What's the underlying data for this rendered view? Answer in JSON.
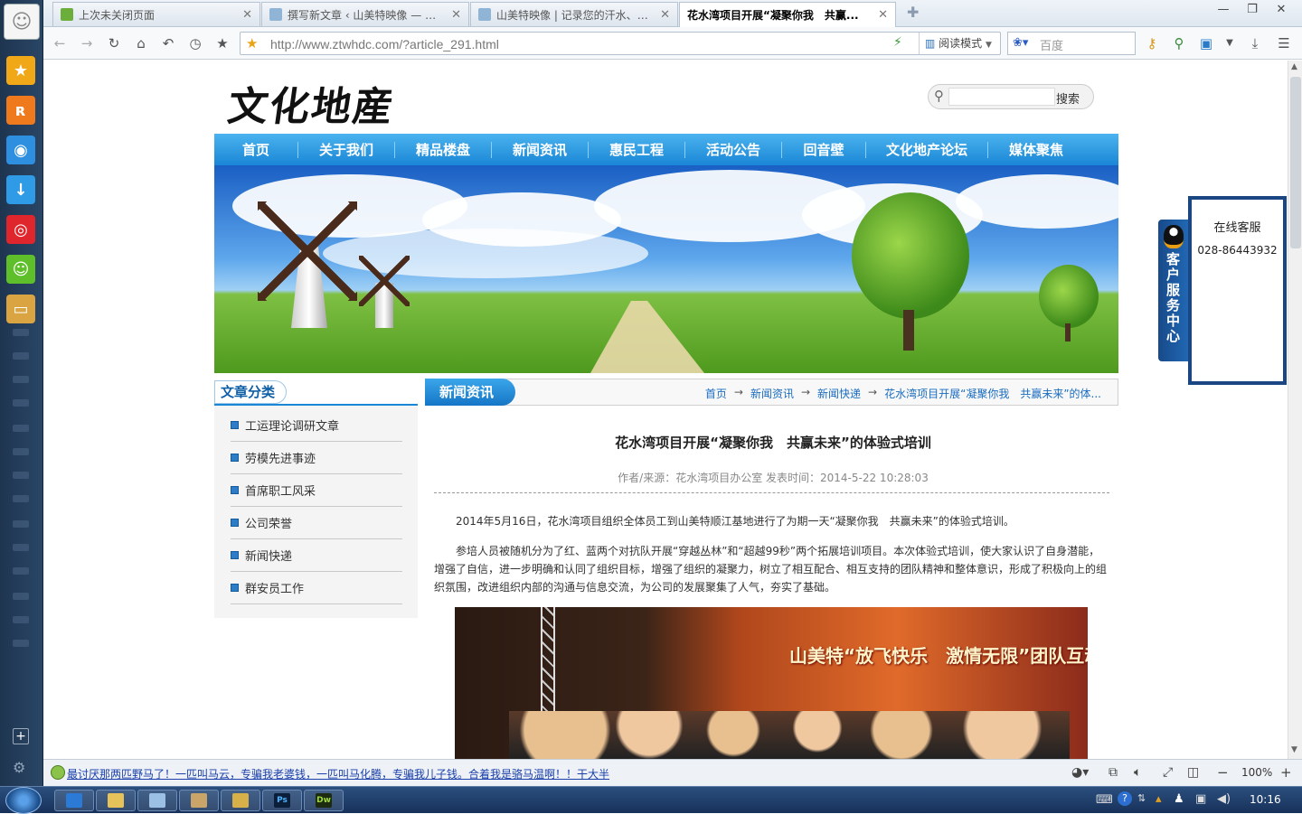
{
  "browser": {
    "tabs": [
      {
        "label": "上次未关闭页面",
        "icon": "restore-icon"
      },
      {
        "label": "撰写新文章 ‹ 山美特映像 — Wor...",
        "icon": "wordpress-icon"
      },
      {
        "label": "山美特映像 | 记录您的汗水、泪...",
        "icon": "wordpress-icon"
      },
      {
        "label": "花水湾项目开展“凝聚你我　共赢...",
        "icon": "page-icon"
      }
    ],
    "url": "http://www.ztwhdc.com/?article_291.html",
    "reader_mode": "阅读模式",
    "search_placeholder": "百度",
    "zoom": "100%"
  },
  "site": {
    "logo": "文化地産",
    "search_button": "搜索",
    "nav": [
      "首页",
      "关于我们",
      "精品楼盘",
      "新闻资讯",
      "惠民工程",
      "活动公告",
      "回音壁",
      "文化地产论坛",
      "媒体聚焦"
    ],
    "category_title": "文章分类",
    "categories": [
      "工运理论调研文章",
      "劳模先进事迹",
      "首席职工风采",
      "公司荣誉",
      "新闻快递",
      "群安员工作"
    ],
    "section_title": "新闻资讯",
    "breadcrumb": [
      "首页",
      "新闻资讯",
      "新闻快递",
      "花水湾项目开展“凝聚你我　共赢未来”的体..."
    ],
    "article": {
      "title": "花水湾项目开展“凝聚你我　共赢未来”的体验式培训",
      "meta": "作者/来源：花水湾项目办公室  发表时间：2014-5-22 10:28:03",
      "paragraphs": [
        "2014年5月16日，花水湾项目组织全体员工到山美特顺江基地进行了为期一天“凝聚你我　共赢未来”的体验式培训。",
        "参培人员被随机分为了红、蓝两个对抗队开展“穿越丛林”和“超越99秒”两个拓展培训项目。本次体验式培训，使大家认识了自身潜能，增强了自信，进一步明确和认同了组织目标，增强了组织的凝聚力，树立了相互配合、相互支持的团队精神和整体意识，形成了积极向上的组织氛围，改进组织内部的沟通与信息交流，为公司的发展聚集了人气，夯实了基础。"
      ],
      "photo_banner": "山美特“放飞快乐　激情无限”团队互动篝..."
    }
  },
  "service": {
    "tab_label": "客户服务中心",
    "box_title": "在线客服",
    "phone": "028-86443932"
  },
  "status_bar": {
    "message": "最讨厌那两匹野马了！一匹叫马云，专骗我老婆钱，一匹叫马化腾，专骗我儿子钱。合着我是骆马温啊！！干大半"
  },
  "taskbar": {
    "clock": "10:16"
  },
  "colors": {
    "nav_blue": "#1a86d6",
    "link_blue": "#1a6cc0",
    "service_navy": "#1a4783"
  }
}
